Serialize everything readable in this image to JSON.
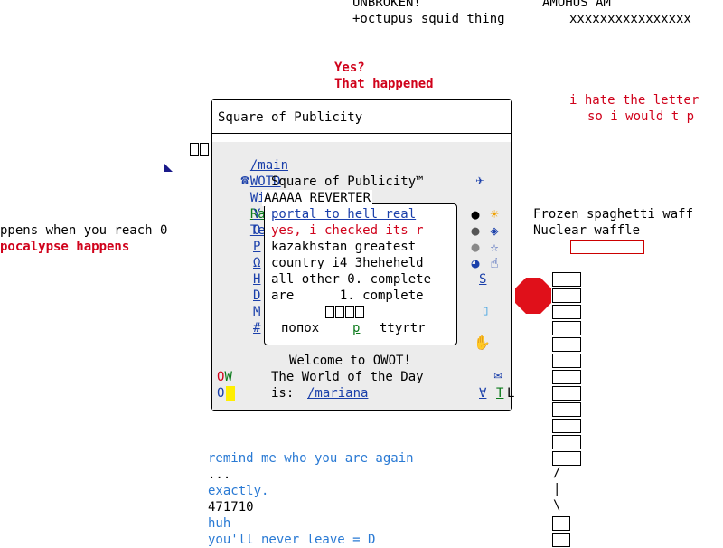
{
  "top": {
    "unbroken": "UNBROKEN!",
    "amogus": "AMOHUS AM",
    "octopus": "+octupus squid thing",
    "xs": "xxxxxxxxxxxxxxxx"
  },
  "upper_chat": {
    "yes": "Yes?",
    "happened": "That happened"
  },
  "right_notes": {
    "hate": "i hate the letter",
    "would": "so i would t p"
  },
  "left_notes": {
    "reach": "ppens when you reach 0",
    "apocalypse": "pocalypse happens"
  },
  "frozen": {
    "line1": "Frozen spaghetti waff",
    "line2": "Nuclear waffle"
  },
  "panel": {
    "title": "Square of Publicity",
    "nav": [
      "/main",
      "WOTD",
      "Wiki",
      "Ratings",
      "Test"
    ],
    "heading": "Square of Publicity™",
    "side_letters": [
      "Y",
      "O",
      "P",
      "Ω",
      "H",
      "D",
      "M",
      "#"
    ],
    "welcome": "Welcome to OWOT!",
    "wotd_label": "The World of the Day",
    "wotd_is": "is:",
    "wotd_link": "/mariana",
    "left_ow": "OW",
    "left_o": "O",
    "bottom_right": "∀",
    "bottom_t": "T",
    "bottom_l": "L",
    "s_link": "S"
  },
  "inner_box": {
    "caption": "AAAAA REVERTER",
    "lines": [
      "portal to hell real",
      "yes, i checked its r",
      "kazakhstan greatest",
      "country i4 3heheheld",
      "all other 0. complete",
      "are      1. complete"
    ],
    "footer_left": "попох",
    "footer_mid": "p",
    "footer_right": "ttyrtr"
  },
  "bottom_chat": {
    "remind": "remind me who you are again",
    "dots": "...",
    "exactly": "exactly.",
    "number": "471710",
    "huh": "huh",
    "never": "you'll never leave = D"
  },
  "right_column": {
    "slash": "/",
    "bar": "|",
    "backslash": "\\"
  },
  "colors": {
    "red": "#d0021b",
    "blue": "#1a3faa",
    "green": "#0a7a1a",
    "panel_bg": "#ececec",
    "stop_sign": "#e0101a",
    "highlight": "#ffee00"
  },
  "icons": [
    "sun-icon",
    "star-icon",
    "pointing-hand-icon",
    "phone-icon",
    "stop-sign-icon",
    "scroll-icon"
  ]
}
